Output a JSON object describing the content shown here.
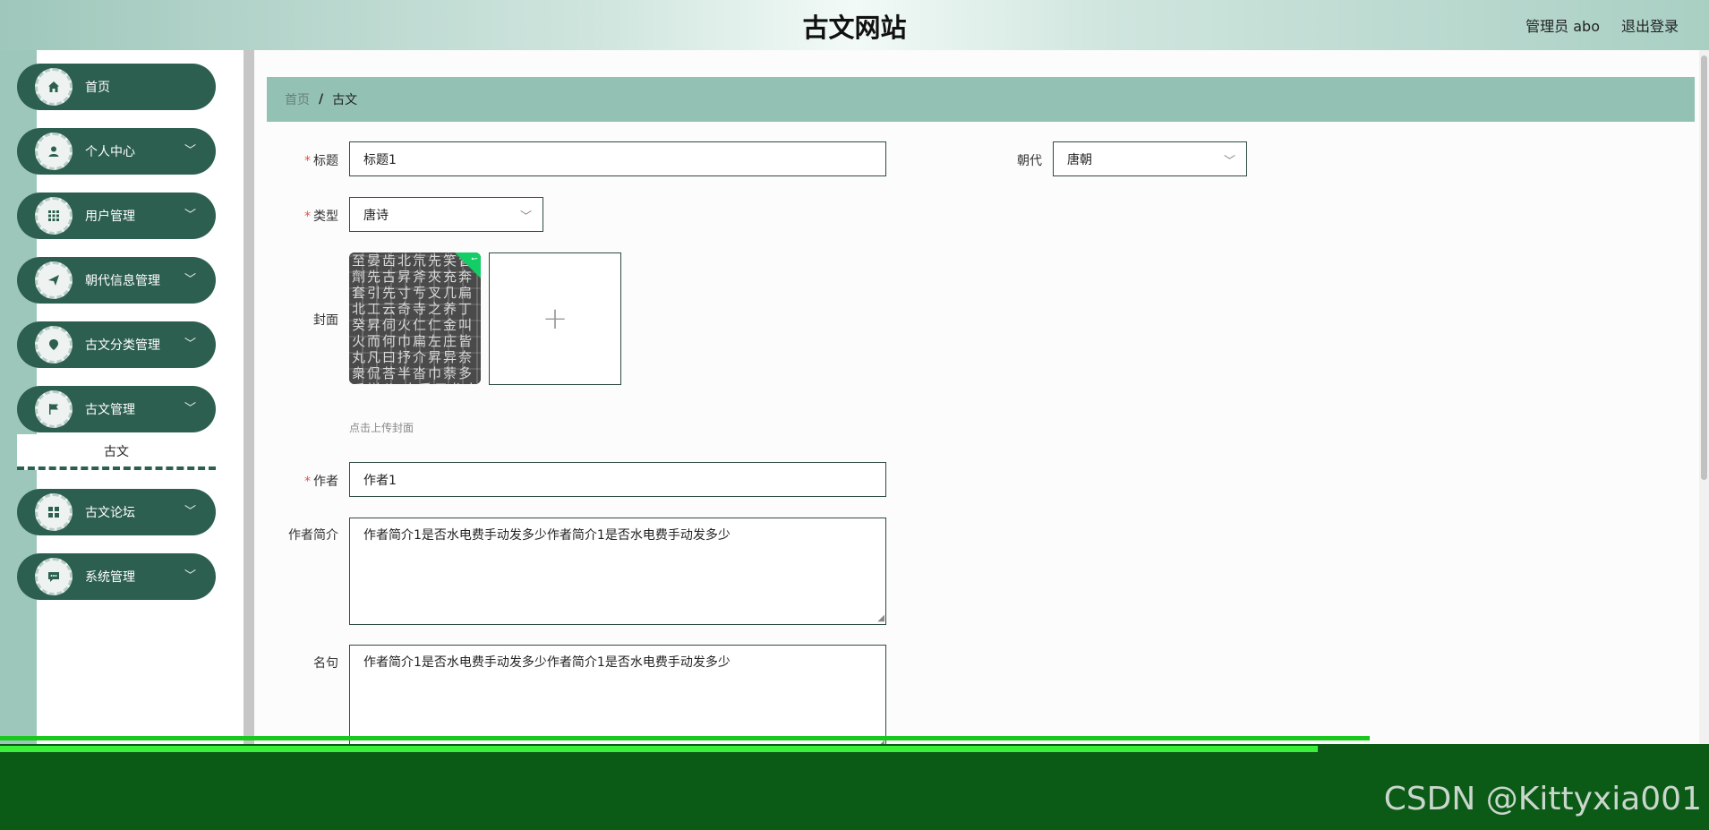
{
  "header": {
    "title": "古文网站",
    "user_label": "管理员 abo",
    "logout_label": "退出登录"
  },
  "sidebar": {
    "items": [
      {
        "label": "首页",
        "icon": "home-icon",
        "has_children": false
      },
      {
        "label": "个人中心",
        "icon": "user-icon",
        "has_children": true
      },
      {
        "label": "用户管理",
        "icon": "grid-icon",
        "has_children": true
      },
      {
        "label": "朝代信息管理",
        "icon": "send-icon",
        "has_children": true
      },
      {
        "label": "古文分类管理",
        "icon": "location-icon",
        "has_children": true
      },
      {
        "label": "古文管理",
        "icon": "flag-icon",
        "has_children": true
      },
      {
        "label": "古文论坛",
        "icon": "apps-icon",
        "has_children": true
      },
      {
        "label": "系统管理",
        "icon": "chat-icon",
        "has_children": true
      }
    ],
    "submenu_active": "古文"
  },
  "breadcrumb": {
    "home": "首页",
    "separator": "/",
    "current": "古文"
  },
  "form": {
    "title": {
      "label": "标题",
      "value": "标题1",
      "required": true
    },
    "dynasty": {
      "label": "朝代",
      "value": "唐朝"
    },
    "type": {
      "label": "类型",
      "value": "唐诗",
      "required": true
    },
    "cover": {
      "label": "封面",
      "upload_tip": "点击上传封面",
      "add_symbol": "+",
      "image_chars": "至晏齿北氘先笑晋劑先古昇斧夾充奔套引先寸亐叉几扁北工云奇寺之养丁癸昇伺火仁仁金叫火而何巾扁左庄皆丸凡曰抒介昇异奈衆侃荅半沓巾萘多瓜拼公 本乘用龙十冬瓜"
    },
    "author": {
      "label": "作者",
      "value": "作者1",
      "required": true
    },
    "author_intro": {
      "label": "作者简介",
      "value": "作者简介1是否水电费手动发多少作者简介1是否水电费手动发多少"
    },
    "famous_line": {
      "label": "名句",
      "value": "作者简介1是否水电费手动发多少作者简介1是否水电费手动发多少"
    }
  },
  "watermark": "CSDN @Kittyxia001",
  "colors": {
    "sidebar_item": "#2c5f4f",
    "breadcrumb_bg": "#93c2b5",
    "required": "#e5534b",
    "upload_success": "#13ce66"
  }
}
